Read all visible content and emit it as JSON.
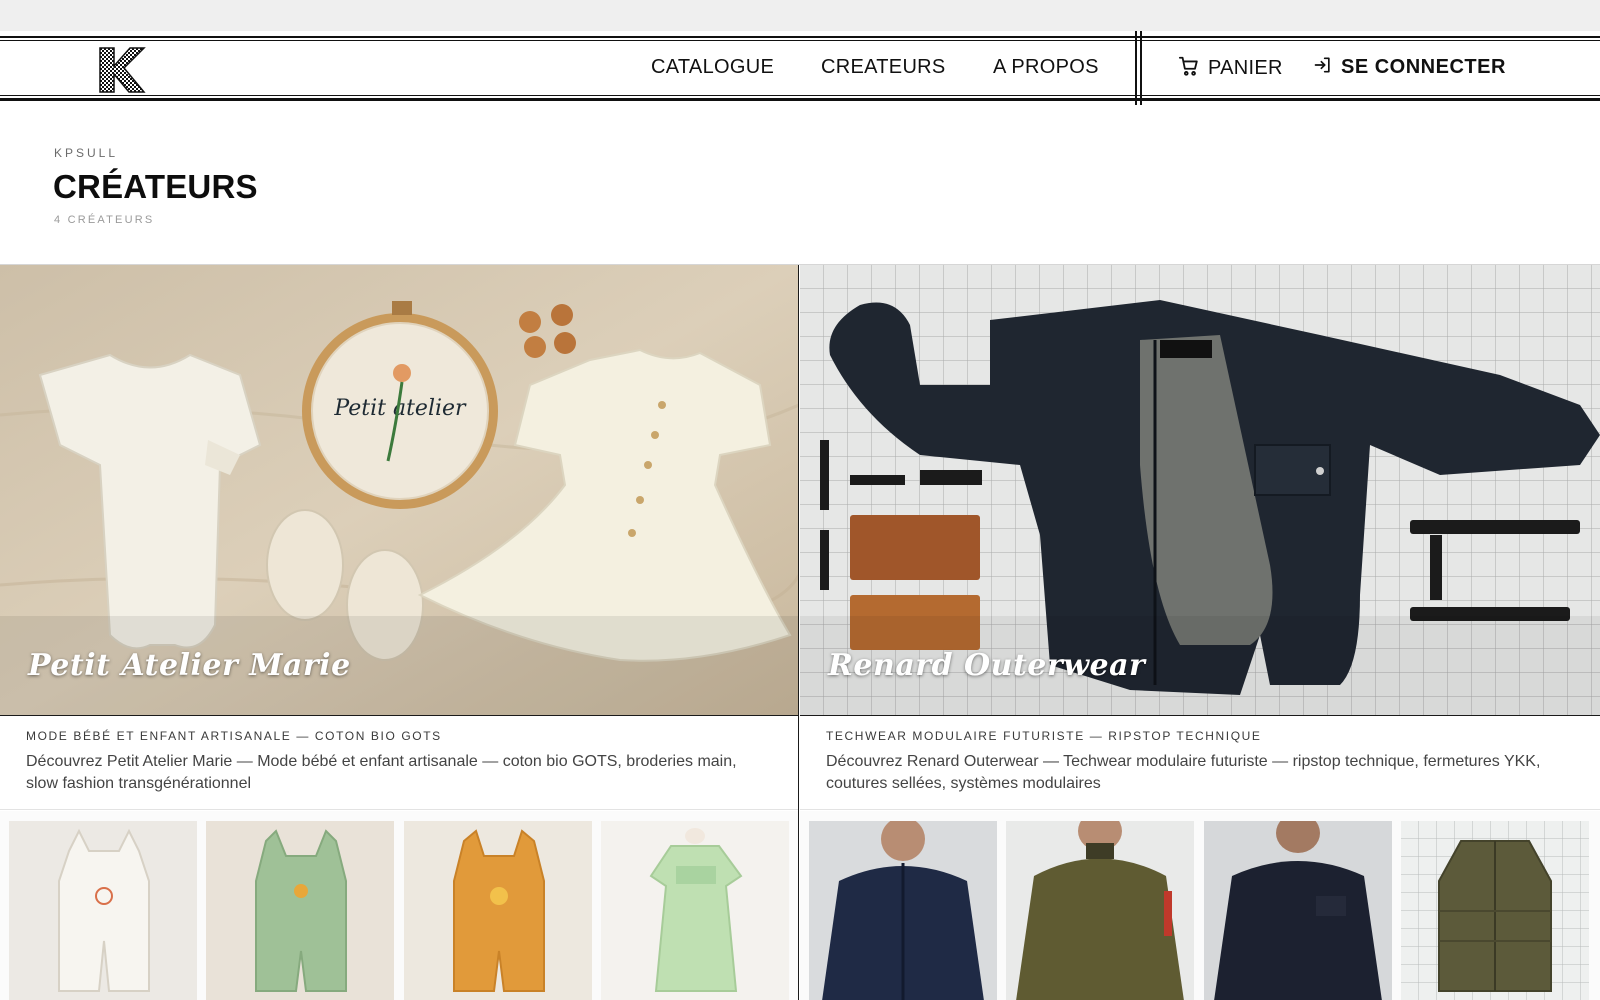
{
  "header": {
    "nav": [
      {
        "label": "CATALOGUE"
      },
      {
        "label": "CREATEURS"
      },
      {
        "label": "A PROPOS"
      }
    ],
    "cart_label": "PANIER",
    "login_label": "SE CONNECTER"
  },
  "page": {
    "eyebrow": "KPSULL",
    "title": "CRÉATEURS",
    "count": "4 CRÉATEURS"
  },
  "creators": [
    {
      "name": "Petit Atelier Marie",
      "tagline": "MODE BÉBÉ ET ENFANT ARTISANALE — COTON BIO GOTS",
      "description": "Découvrez Petit Atelier Marie — Mode bébé et enfant artisanale — coton bio GOTS, broderies main, slow fashion transgénérationnel",
      "hoop_text": "Petit atelier"
    },
    {
      "name": "Renard Outerwear",
      "tagline": "TECHWEAR MODULAIRE FUTURISTE — RIPSTOP TECHNIQUE",
      "description": "Découvrez Renard Outerwear — Techwear modulaire futuriste — ripstop technique, fermetures YKK, coutures sellées, systèmes modulaires"
    }
  ],
  "colors": {
    "ink": "#111111",
    "muted": "#6b6b6b",
    "linen": "#d9cdb8",
    "grid_board": "#e6e7e6",
    "jacket_navy": "#1f2630"
  },
  "icons": [
    "logo-k-icon",
    "cart-icon",
    "login-icon"
  ]
}
